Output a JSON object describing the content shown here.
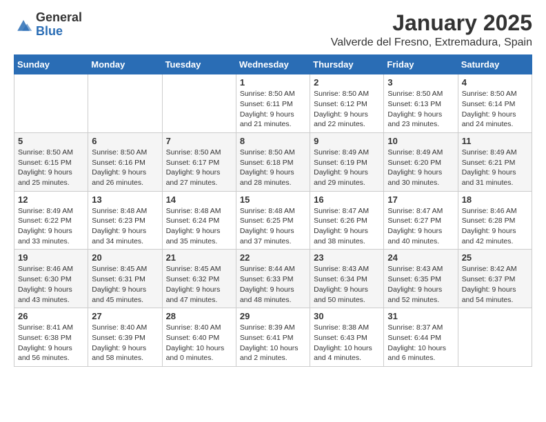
{
  "logo": {
    "general": "General",
    "blue": "Blue"
  },
  "header": {
    "month": "January 2025",
    "location": "Valverde del Fresno, Extremadura, Spain"
  },
  "weekdays": [
    "Sunday",
    "Monday",
    "Tuesday",
    "Wednesday",
    "Thursday",
    "Friday",
    "Saturday"
  ],
  "weeks": [
    [
      {
        "day": "",
        "info": ""
      },
      {
        "day": "",
        "info": ""
      },
      {
        "day": "",
        "info": ""
      },
      {
        "day": "1",
        "info": "Sunrise: 8:50 AM\nSunset: 6:11 PM\nDaylight: 9 hours\nand 21 minutes."
      },
      {
        "day": "2",
        "info": "Sunrise: 8:50 AM\nSunset: 6:12 PM\nDaylight: 9 hours\nand 22 minutes."
      },
      {
        "day": "3",
        "info": "Sunrise: 8:50 AM\nSunset: 6:13 PM\nDaylight: 9 hours\nand 23 minutes."
      },
      {
        "day": "4",
        "info": "Sunrise: 8:50 AM\nSunset: 6:14 PM\nDaylight: 9 hours\nand 24 minutes."
      }
    ],
    [
      {
        "day": "5",
        "info": "Sunrise: 8:50 AM\nSunset: 6:15 PM\nDaylight: 9 hours\nand 25 minutes."
      },
      {
        "day": "6",
        "info": "Sunrise: 8:50 AM\nSunset: 6:16 PM\nDaylight: 9 hours\nand 26 minutes."
      },
      {
        "day": "7",
        "info": "Sunrise: 8:50 AM\nSunset: 6:17 PM\nDaylight: 9 hours\nand 27 minutes."
      },
      {
        "day": "8",
        "info": "Sunrise: 8:50 AM\nSunset: 6:18 PM\nDaylight: 9 hours\nand 28 minutes."
      },
      {
        "day": "9",
        "info": "Sunrise: 8:49 AM\nSunset: 6:19 PM\nDaylight: 9 hours\nand 29 minutes."
      },
      {
        "day": "10",
        "info": "Sunrise: 8:49 AM\nSunset: 6:20 PM\nDaylight: 9 hours\nand 30 minutes."
      },
      {
        "day": "11",
        "info": "Sunrise: 8:49 AM\nSunset: 6:21 PM\nDaylight: 9 hours\nand 31 minutes."
      }
    ],
    [
      {
        "day": "12",
        "info": "Sunrise: 8:49 AM\nSunset: 6:22 PM\nDaylight: 9 hours\nand 33 minutes."
      },
      {
        "day": "13",
        "info": "Sunrise: 8:48 AM\nSunset: 6:23 PM\nDaylight: 9 hours\nand 34 minutes."
      },
      {
        "day": "14",
        "info": "Sunrise: 8:48 AM\nSunset: 6:24 PM\nDaylight: 9 hours\nand 35 minutes."
      },
      {
        "day": "15",
        "info": "Sunrise: 8:48 AM\nSunset: 6:25 PM\nDaylight: 9 hours\nand 37 minutes."
      },
      {
        "day": "16",
        "info": "Sunrise: 8:47 AM\nSunset: 6:26 PM\nDaylight: 9 hours\nand 38 minutes."
      },
      {
        "day": "17",
        "info": "Sunrise: 8:47 AM\nSunset: 6:27 PM\nDaylight: 9 hours\nand 40 minutes."
      },
      {
        "day": "18",
        "info": "Sunrise: 8:46 AM\nSunset: 6:28 PM\nDaylight: 9 hours\nand 42 minutes."
      }
    ],
    [
      {
        "day": "19",
        "info": "Sunrise: 8:46 AM\nSunset: 6:30 PM\nDaylight: 9 hours\nand 43 minutes."
      },
      {
        "day": "20",
        "info": "Sunrise: 8:45 AM\nSunset: 6:31 PM\nDaylight: 9 hours\nand 45 minutes."
      },
      {
        "day": "21",
        "info": "Sunrise: 8:45 AM\nSunset: 6:32 PM\nDaylight: 9 hours\nand 47 minutes."
      },
      {
        "day": "22",
        "info": "Sunrise: 8:44 AM\nSunset: 6:33 PM\nDaylight: 9 hours\nand 48 minutes."
      },
      {
        "day": "23",
        "info": "Sunrise: 8:43 AM\nSunset: 6:34 PM\nDaylight: 9 hours\nand 50 minutes."
      },
      {
        "day": "24",
        "info": "Sunrise: 8:43 AM\nSunset: 6:35 PM\nDaylight: 9 hours\nand 52 minutes."
      },
      {
        "day": "25",
        "info": "Sunrise: 8:42 AM\nSunset: 6:37 PM\nDaylight: 9 hours\nand 54 minutes."
      }
    ],
    [
      {
        "day": "26",
        "info": "Sunrise: 8:41 AM\nSunset: 6:38 PM\nDaylight: 9 hours\nand 56 minutes."
      },
      {
        "day": "27",
        "info": "Sunrise: 8:40 AM\nSunset: 6:39 PM\nDaylight: 9 hours\nand 58 minutes."
      },
      {
        "day": "28",
        "info": "Sunrise: 8:40 AM\nSunset: 6:40 PM\nDaylight: 10 hours\nand 0 minutes."
      },
      {
        "day": "29",
        "info": "Sunrise: 8:39 AM\nSunset: 6:41 PM\nDaylight: 10 hours\nand 2 minutes."
      },
      {
        "day": "30",
        "info": "Sunrise: 8:38 AM\nSunset: 6:43 PM\nDaylight: 10 hours\nand 4 minutes."
      },
      {
        "day": "31",
        "info": "Sunrise: 8:37 AM\nSunset: 6:44 PM\nDaylight: 10 hours\nand 6 minutes."
      },
      {
        "day": "",
        "info": ""
      }
    ]
  ]
}
